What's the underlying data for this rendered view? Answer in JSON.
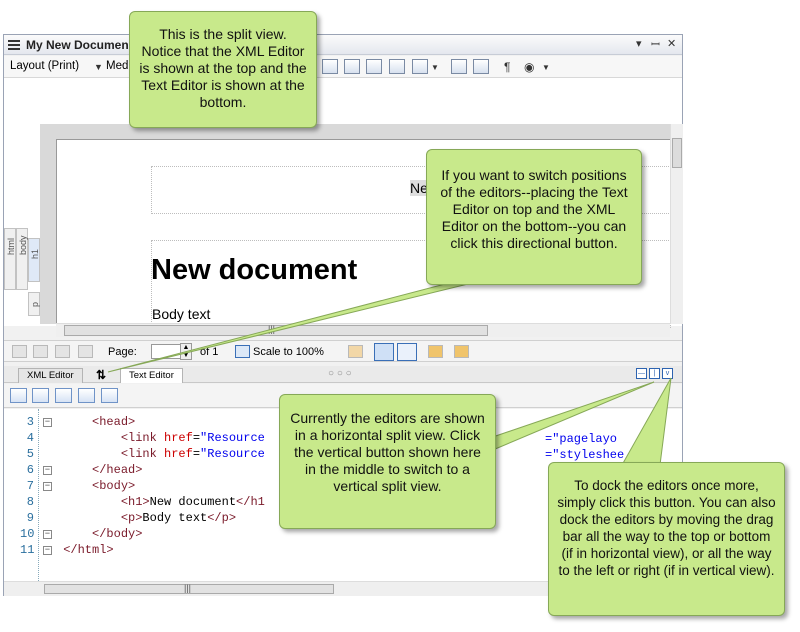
{
  "window": {
    "title": "My New Documen",
    "layout_label": "Layout (Print)",
    "media_label": "Med",
    "para_glyph": "¶"
  },
  "document": {
    "heading": "New document",
    "body": "Body text",
    "partial_title": "Ne"
  },
  "structure_tabs": [
    "html",
    "body",
    "h1",
    "p"
  ],
  "navbar": {
    "page_label": "Page:",
    "page_value": "1",
    "of_label": "of 1",
    "scale_label": "Scale to 100%"
  },
  "editor_tabs": {
    "xml": "XML Editor",
    "text": "Text Editor"
  },
  "code_lines": [
    {
      "num": "3",
      "pre": "     ",
      "html": "<span class=\"tag\">&lt;head&gt;</span>"
    },
    {
      "num": "4",
      "pre": "         ",
      "html": "<span class=\"tag\">&lt;link</span> <span class=\"attr\">href</span>=<span class=\"val\">\"Resource</span>"
    },
    {
      "num": "5",
      "pre": "         ",
      "html": "<span class=\"tag\">&lt;link</span> <span class=\"attr\">href</span>=<span class=\"val\">\"Resource</span>"
    },
    {
      "num": "6",
      "pre": "     ",
      "html": "<span class=\"tag\">&lt;/head&gt;</span>"
    },
    {
      "num": "7",
      "pre": "     ",
      "html": "<span class=\"tag\">&lt;body&gt;</span>"
    },
    {
      "num": "8",
      "pre": "         ",
      "html": "<span class=\"tag\">&lt;h1&gt;</span>New document<span class=\"tag\">&lt;/h1</span>"
    },
    {
      "num": "9",
      "pre": "         ",
      "html": "<span class=\"tag\">&lt;p&gt;</span>Body text<span class=\"tag\">&lt;/p&gt;</span>"
    },
    {
      "num": "10",
      "pre": "     ",
      "html": "<span class=\"tag\">&lt;/body&gt;</span>"
    },
    {
      "num": "11",
      "pre": " ",
      "html": "<span class=\"tag\">&lt;/html&gt;</span>"
    }
  ],
  "code_tail_4": "=\"pagelayo",
  "code_tail_5": "=\"styleshee",
  "callouts": {
    "split_view": "This is the split view. Notice that the XML Editor is shown at the top and the Text Editor is shown at the bottom.",
    "switch_positions": "If you want to switch positions of the editors--placing the Text Editor on top and the XML Editor on the bottom--you can click this directional button.",
    "horizontal_split": "Currently the editors are shown in a horizontal split view. Click the vertical button shown here in the middle to switch to a vertical split view.",
    "dock": "To dock the editors once more, simply click this button. You can also dock the editors by moving the drag bar all the way to the top or bottom (if in horizontal view), or all the way to the left or right (if in vertical view)."
  },
  "colors": {
    "callout_bg": "#c8e98b",
    "callout_border": "#86a857",
    "accent_blue": "#2d63b0"
  }
}
